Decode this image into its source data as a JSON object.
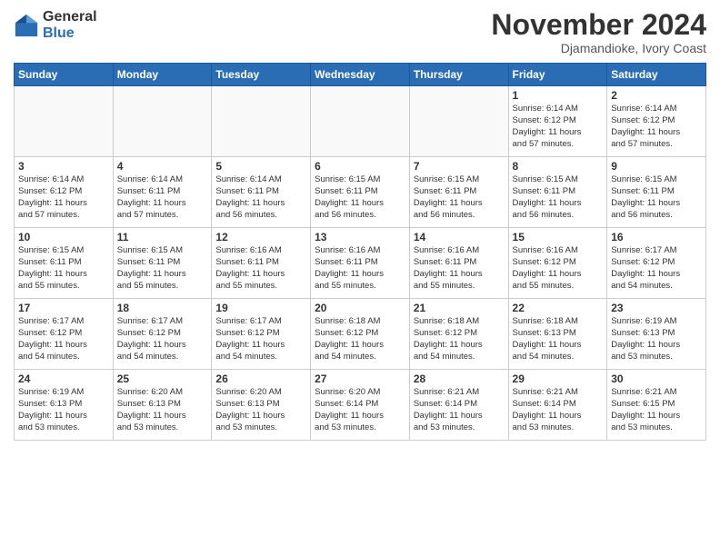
{
  "header": {
    "logo_general": "General",
    "logo_blue": "Blue",
    "month_title": "November 2024",
    "location": "Djamandioke, Ivory Coast"
  },
  "days_of_week": [
    "Sunday",
    "Monday",
    "Tuesday",
    "Wednesday",
    "Thursday",
    "Friday",
    "Saturday"
  ],
  "weeks": [
    [
      {
        "day": "",
        "info": ""
      },
      {
        "day": "",
        "info": ""
      },
      {
        "day": "",
        "info": ""
      },
      {
        "day": "",
        "info": ""
      },
      {
        "day": "",
        "info": ""
      },
      {
        "day": "1",
        "info": "Sunrise: 6:14 AM\nSunset: 6:12 PM\nDaylight: 11 hours\nand 57 minutes."
      },
      {
        "day": "2",
        "info": "Sunrise: 6:14 AM\nSunset: 6:12 PM\nDaylight: 11 hours\nand 57 minutes."
      }
    ],
    [
      {
        "day": "3",
        "info": "Sunrise: 6:14 AM\nSunset: 6:12 PM\nDaylight: 11 hours\nand 57 minutes."
      },
      {
        "day": "4",
        "info": "Sunrise: 6:14 AM\nSunset: 6:11 PM\nDaylight: 11 hours\nand 57 minutes."
      },
      {
        "day": "5",
        "info": "Sunrise: 6:14 AM\nSunset: 6:11 PM\nDaylight: 11 hours\nand 56 minutes."
      },
      {
        "day": "6",
        "info": "Sunrise: 6:15 AM\nSunset: 6:11 PM\nDaylight: 11 hours\nand 56 minutes."
      },
      {
        "day": "7",
        "info": "Sunrise: 6:15 AM\nSunset: 6:11 PM\nDaylight: 11 hours\nand 56 minutes."
      },
      {
        "day": "8",
        "info": "Sunrise: 6:15 AM\nSunset: 6:11 PM\nDaylight: 11 hours\nand 56 minutes."
      },
      {
        "day": "9",
        "info": "Sunrise: 6:15 AM\nSunset: 6:11 PM\nDaylight: 11 hours\nand 56 minutes."
      }
    ],
    [
      {
        "day": "10",
        "info": "Sunrise: 6:15 AM\nSunset: 6:11 PM\nDaylight: 11 hours\nand 55 minutes."
      },
      {
        "day": "11",
        "info": "Sunrise: 6:15 AM\nSunset: 6:11 PM\nDaylight: 11 hours\nand 55 minutes."
      },
      {
        "day": "12",
        "info": "Sunrise: 6:16 AM\nSunset: 6:11 PM\nDaylight: 11 hours\nand 55 minutes."
      },
      {
        "day": "13",
        "info": "Sunrise: 6:16 AM\nSunset: 6:11 PM\nDaylight: 11 hours\nand 55 minutes."
      },
      {
        "day": "14",
        "info": "Sunrise: 6:16 AM\nSunset: 6:11 PM\nDaylight: 11 hours\nand 55 minutes."
      },
      {
        "day": "15",
        "info": "Sunrise: 6:16 AM\nSunset: 6:12 PM\nDaylight: 11 hours\nand 55 minutes."
      },
      {
        "day": "16",
        "info": "Sunrise: 6:17 AM\nSunset: 6:12 PM\nDaylight: 11 hours\nand 54 minutes."
      }
    ],
    [
      {
        "day": "17",
        "info": "Sunrise: 6:17 AM\nSunset: 6:12 PM\nDaylight: 11 hours\nand 54 minutes."
      },
      {
        "day": "18",
        "info": "Sunrise: 6:17 AM\nSunset: 6:12 PM\nDaylight: 11 hours\nand 54 minutes."
      },
      {
        "day": "19",
        "info": "Sunrise: 6:17 AM\nSunset: 6:12 PM\nDaylight: 11 hours\nand 54 minutes."
      },
      {
        "day": "20",
        "info": "Sunrise: 6:18 AM\nSunset: 6:12 PM\nDaylight: 11 hours\nand 54 minutes."
      },
      {
        "day": "21",
        "info": "Sunrise: 6:18 AM\nSunset: 6:12 PM\nDaylight: 11 hours\nand 54 minutes."
      },
      {
        "day": "22",
        "info": "Sunrise: 6:18 AM\nSunset: 6:13 PM\nDaylight: 11 hours\nand 54 minutes."
      },
      {
        "day": "23",
        "info": "Sunrise: 6:19 AM\nSunset: 6:13 PM\nDaylight: 11 hours\nand 53 minutes."
      }
    ],
    [
      {
        "day": "24",
        "info": "Sunrise: 6:19 AM\nSunset: 6:13 PM\nDaylight: 11 hours\nand 53 minutes."
      },
      {
        "day": "25",
        "info": "Sunrise: 6:20 AM\nSunset: 6:13 PM\nDaylight: 11 hours\nand 53 minutes."
      },
      {
        "day": "26",
        "info": "Sunrise: 6:20 AM\nSunset: 6:13 PM\nDaylight: 11 hours\nand 53 minutes."
      },
      {
        "day": "27",
        "info": "Sunrise: 6:20 AM\nSunset: 6:14 PM\nDaylight: 11 hours\nand 53 minutes."
      },
      {
        "day": "28",
        "info": "Sunrise: 6:21 AM\nSunset: 6:14 PM\nDaylight: 11 hours\nand 53 minutes."
      },
      {
        "day": "29",
        "info": "Sunrise: 6:21 AM\nSunset: 6:14 PM\nDaylight: 11 hours\nand 53 minutes."
      },
      {
        "day": "30",
        "info": "Sunrise: 6:21 AM\nSunset: 6:15 PM\nDaylight: 11 hours\nand 53 minutes."
      }
    ]
  ]
}
